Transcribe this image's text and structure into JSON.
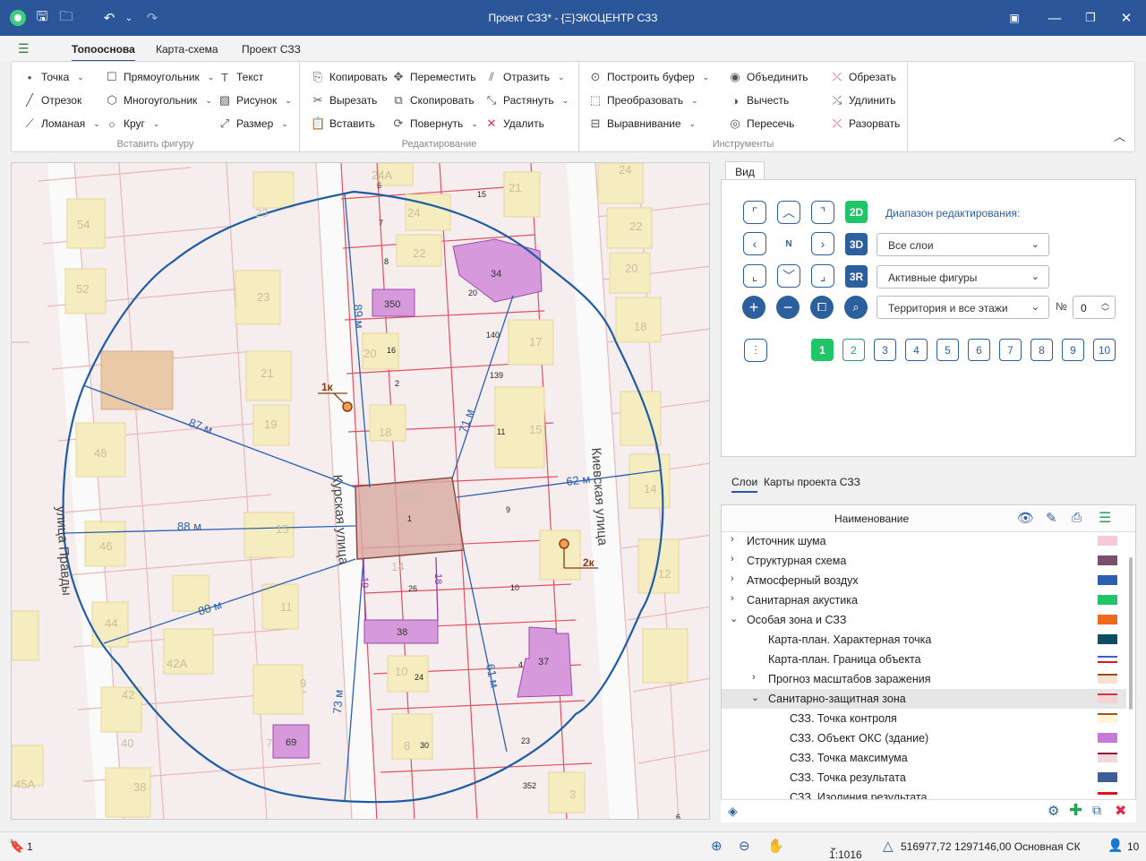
{
  "window": {
    "title": "Проект СЗЗ* - {Ξ}ЭКОЦЕНТР СЗЗ"
  },
  "menu": {
    "tabs": [
      "Топооснова",
      "Карта-схема",
      "Проект СЗЗ"
    ]
  },
  "ribbon": {
    "insert": {
      "label": "Вставить фигуру",
      "items": [
        "Точка",
        "Отрезок",
        "Ломаная",
        "Прямоугольник",
        "Многоугольник",
        "Круг",
        "Текст",
        "Рисунок",
        "Размер"
      ]
    },
    "edit": {
      "label": "Редактирование",
      "items": [
        "Копировать",
        "Вырезать",
        "Вставить",
        "Переместить",
        "Скопировать",
        "Повернуть",
        "Отразить",
        "Растянуть",
        "Удалить"
      ]
    },
    "tools": {
      "label": "Инструменты",
      "items": [
        "Построить буфер",
        "Преобразовать",
        "Выравнивание",
        "Объединить",
        "Вычесть",
        "Пересечь",
        "Обрезать",
        "Удлинить",
        "Разорвать"
      ]
    }
  },
  "map": {
    "streets": [
      "Курская улица",
      "Киевская улица",
      "улица Правды"
    ],
    "distances": [
      "89 м",
      "87 м",
      "71 м",
      "62 м",
      "88 м",
      "80 м",
      "73 м",
      "61 м",
      "19",
      "18"
    ],
    "points": [
      "1к",
      "2к"
    ],
    "house_numbers": [
      "24А",
      "6",
      "15",
      "21",
      "24",
      "24",
      "7",
      "54",
      "23",
      "22",
      "22",
      "8",
      "34",
      "20",
      "52",
      "350",
      "20",
      "23",
      "18",
      "140",
      "16",
      "17",
      "21",
      "20",
      "2",
      "139",
      "19",
      "18",
      "11",
      "15",
      "48",
      "18В",
      "1",
      "9",
      "14",
      "46",
      "15",
      "14",
      "26",
      "10",
      "12",
      "11",
      "44",
      "38",
      "37",
      "4",
      "42А",
      "10",
      "24",
      "9",
      "42",
      "69",
      "30",
      "8",
      "23",
      "40",
      "7",
      "38",
      "352",
      "3",
      "45А",
      "6"
    ]
  },
  "view_panel": {
    "tab": "Вид",
    "range_label": "Диапазон редактирования:",
    "modes": [
      "2D",
      "3D",
      "3R"
    ],
    "north": "N",
    "selects": [
      "Все слои",
      "Активные фигуры",
      "Территория и все этажи"
    ],
    "floor_label": "№",
    "floor_value": "0",
    "pages": [
      "1",
      "2",
      "3",
      "4",
      "5",
      "6",
      "7",
      "8",
      "9",
      "10"
    ]
  },
  "layers_panel": {
    "tabs": [
      "Слои",
      "Карты проекта СЗЗ"
    ],
    "header": "Наименование",
    "rows": [
      {
        "label": "Источник шума",
        "color": "#f6c8d8"
      },
      {
        "label": "Структурная схема",
        "color": "#7a4f6e"
      },
      {
        "label": "Атмосферный воздух",
        "color": "#2b60b0"
      },
      {
        "label": "Санитарная акустика",
        "color": "#22c46a"
      },
      {
        "label": "Особая зона и СЗЗ",
        "color": "#f06a1e"
      },
      {
        "label": "Карта-план. Характерная точка",
        "color": "#0f4d63"
      },
      {
        "label": "Карта-план. Граница объекта",
        "color": "#3a5fcf"
      },
      {
        "label": "Прогноз масштабов заражения",
        "color": "#9b4b1a"
      },
      {
        "label": "Санитарно-защитная зона",
        "color": "#d9304a"
      },
      {
        "label": "СЗЗ. Точка контроля",
        "color": "#a0521a"
      },
      {
        "label": "СЗЗ. Объект ОКС (здание)",
        "color": "#c77ad6"
      },
      {
        "label": "СЗЗ. Точка максимума",
        "color": "#8e1230"
      },
      {
        "label": "СЗЗ. Точка результата",
        "color": "#3b5f96"
      },
      {
        "label": "СЗЗ. Изолиния результата",
        "color": "#e0151d"
      }
    ]
  },
  "status": {
    "page": "1",
    "scale": "1:1016",
    "coords": "516977,72 1297146,00 Основная СК",
    "count": "10"
  }
}
